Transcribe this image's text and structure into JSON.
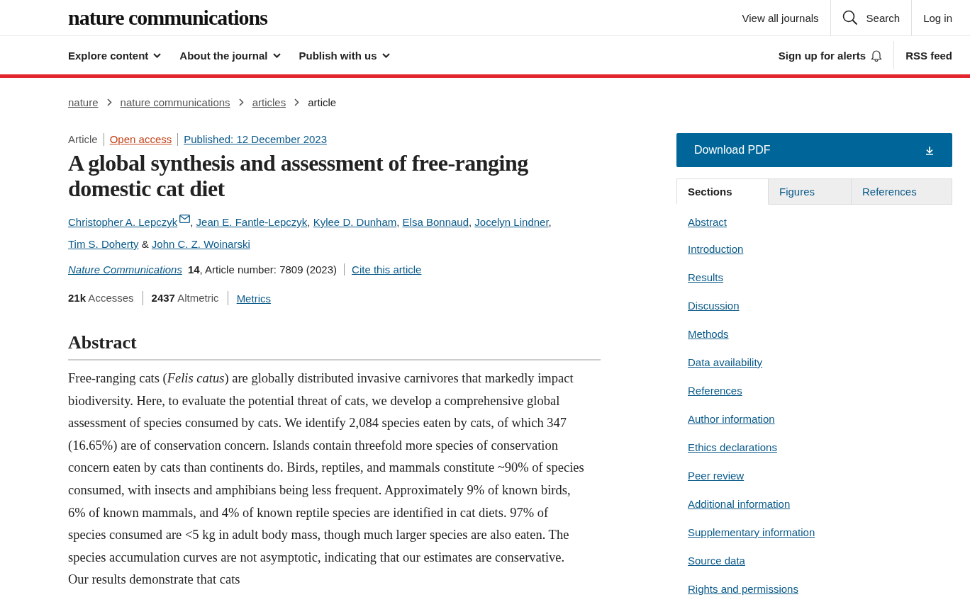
{
  "header": {
    "logo": "nature communications",
    "links": [
      {
        "kind": "link",
        "label": "View all journals"
      },
      {
        "kind": "search",
        "label": "Search"
      },
      {
        "kind": "link",
        "label": "Log in"
      }
    ]
  },
  "nav": {
    "menus": [
      {
        "label": "Explore content"
      },
      {
        "label": "About the journal"
      },
      {
        "label": "Publish with us"
      }
    ],
    "right": [
      {
        "kind": "alerts",
        "label": "Sign up for alerts"
      },
      {
        "kind": "link",
        "label": "RSS feed"
      }
    ]
  },
  "breadcrumbs": [
    {
      "label": "nature",
      "link": true
    },
    {
      "label": "nature communications",
      "link": true
    },
    {
      "label": "articles",
      "link": true
    },
    {
      "label": "article",
      "link": false
    }
  ],
  "article": {
    "type": "Article",
    "access": "Open access",
    "published": "Published: 12 December 2023",
    "title": "A global synthesis and assessment of free-ranging domestic cat diet",
    "authors": [
      {
        "name": "Christopher A. Lepczyk",
        "contact": true,
        "separator": ","
      },
      {
        "name": "Jean E. Fantle-Lepczyk",
        "contact": false,
        "separator": ","
      },
      {
        "name": "Kylee D. Dunham",
        "contact": false,
        "separator": ","
      },
      {
        "name": "Elsa Bonnaud",
        "contact": false,
        "separator": ","
      },
      {
        "name": "Jocelyn Lindner",
        "contact": false,
        "separator": ","
      },
      {
        "name": "Tim S. Doherty",
        "contact": false,
        "separator": "&"
      },
      {
        "name": "John C. Z. Woinarski",
        "contact": false
      }
    ],
    "journal": "Nature Communications",
    "volume": "14",
    "article_number": ", Article number: 7809 (2023)",
    "cite": "Cite this article",
    "metrics": [
      "**21k** Accesses",
      "**2437** Altmetric"
    ],
    "metrics_link": "Metrics",
    "abstract_heading": "Abstract",
    "abstract": "Free-ranging cats (*Felis catus*) are globally distributed invasive carnivores that markedly impact biodiversity. Here, to evaluate the potential threat of cats, we develop a comprehensive global assessment of species consumed by cats. We identify 2,084 species eaten by cats, of which 347 (16.65%) are of conservation concern. Islands contain threefold more species of conservation concern eaten by cats than continents do. Birds, reptiles, and mammals constitute ~90% of species consumed, with insects and amphibians being less frequent. Approximately 9% of known birds, 6% of known mammals, and 4% of known reptile species are identified in cat diets. 97% of species consumed are <5 kg in adult body mass, though much larger species are also eaten. The species accumulation curves are not asymptotic, indicating that our estimates are conservative. Our results demonstrate that cats"
  },
  "sidebar": {
    "download": "Download PDF",
    "tabs": [
      {
        "label": "Sections",
        "selected": true
      },
      {
        "label": "Figures",
        "selected": false
      },
      {
        "label": "References",
        "selected": false
      }
    ],
    "sections": [
      "Abstract",
      "Introduction",
      "Results",
      "Discussion",
      "Methods",
      "Data availability",
      "References",
      "Author information",
      "Ethics declarations",
      "Peer review",
      "Additional information",
      "Supplementary information",
      "Source data",
      "Rights and permissions"
    ]
  }
}
